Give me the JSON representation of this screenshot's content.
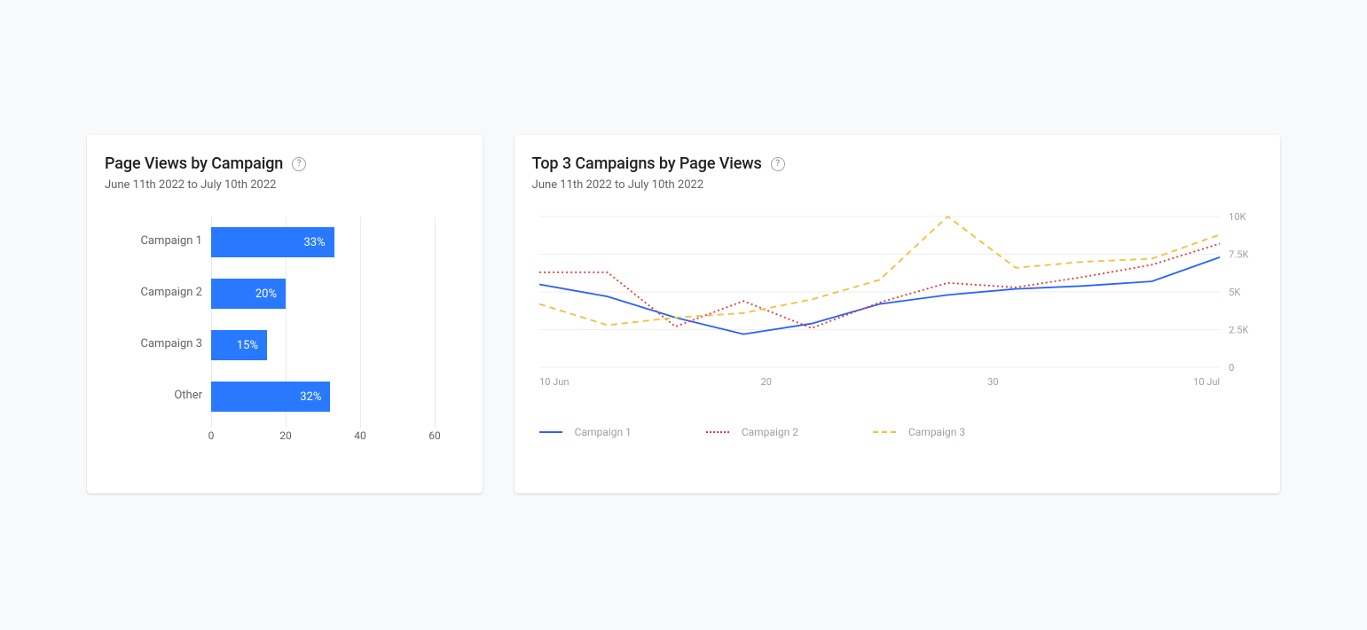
{
  "date_range": "June 11th 2022 to July 10th 2022",
  "bar_card": {
    "title": "Page Views by Campaign",
    "subheading": "June 11th 2022 to July 10th 2022"
  },
  "line_card": {
    "title": "Top 3 Campaigns by Page Views",
    "subheading": "June 11th 2022 to July 10th 2022"
  },
  "chart_data": [
    {
      "type": "bar",
      "orientation": "horizontal",
      "title": "Page Views by Campaign",
      "categories": [
        "Campaign 1",
        "Campaign 2",
        "Campaign 3",
        "Other"
      ],
      "values": [
        33,
        20,
        15,
        32
      ],
      "value_suffix": "%",
      "xlabel": "",
      "ylabel": "",
      "xlim": [
        0,
        60
      ],
      "x_ticks": [
        0,
        20,
        40,
        60
      ],
      "bar_color": "#2979ff"
    },
    {
      "type": "line",
      "title": "Top 3 Campaigns by Page Views",
      "x": [
        10,
        13,
        16,
        19,
        22,
        25,
        28,
        31,
        34,
        37,
        40
      ],
      "x_tick_labels": [
        "10 Jun",
        "20",
        "30",
        "10 Jul"
      ],
      "x_tick_positions": [
        10,
        20,
        30,
        40
      ],
      "y_ticks": [
        0,
        2500,
        5000,
        7500,
        10000
      ],
      "y_tick_labels": [
        "0",
        "2.5K",
        "5K",
        "7.5K",
        "10K"
      ],
      "ylim": [
        0,
        10000
      ],
      "series": [
        {
          "name": "Campaign 1",
          "color": "#2962ff",
          "style": "solid",
          "values": [
            5500,
            4700,
            3300,
            2200,
            2900,
            4200,
            4800,
            5200,
            5400,
            5700,
            7300
          ]
        },
        {
          "name": "Campaign 2",
          "color": "#e53935",
          "style": "dotted",
          "values": [
            6300,
            6300,
            2700,
            4400,
            2600,
            4300,
            5600,
            5300,
            6000,
            6800,
            8200
          ]
        },
        {
          "name": "Campaign 3",
          "color": "#f2c037",
          "style": "dashed",
          "values": [
            4200,
            2800,
            3300,
            3600,
            4500,
            5800,
            10000,
            6600,
            7000,
            7200,
            8800
          ]
        }
      ],
      "legend": [
        "Campaign 1",
        "Campaign 2",
        "Campaign 3"
      ]
    }
  ]
}
